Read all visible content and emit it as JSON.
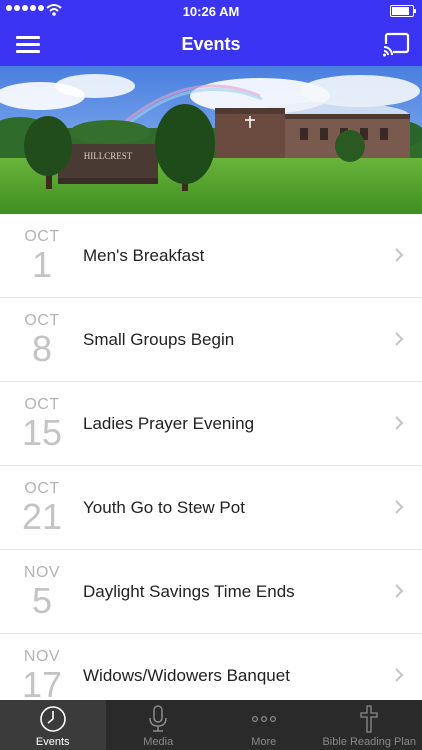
{
  "status_bar": {
    "time": "10:26 AM",
    "battery_level": 0.95
  },
  "nav": {
    "title": "Events"
  },
  "hero": {
    "sign_text": "HILLCREST"
  },
  "events": [
    {
      "month": "OCT",
      "day": "1",
      "name": "Men's Breakfast"
    },
    {
      "month": "OCT",
      "day": "8",
      "name": "Small Groups Begin"
    },
    {
      "month": "OCT",
      "day": "15",
      "name": "Ladies Prayer Evening"
    },
    {
      "month": "OCT",
      "day": "21",
      "name": "Youth Go to Stew Pot"
    },
    {
      "month": "NOV",
      "day": "5",
      "name": "Daylight Savings Time Ends"
    },
    {
      "month": "NOV",
      "day": "17",
      "name": "Widows/Widowers Banquet"
    }
  ],
  "tabs": [
    {
      "label": "Events",
      "icon": "clock-icon"
    },
    {
      "label": "Media",
      "icon": "microphone-icon"
    },
    {
      "label": "More",
      "icon": "ellipsis-icon"
    },
    {
      "label": "Bible Reading Plan",
      "icon": "cross-icon"
    }
  ],
  "colors": {
    "brand": "#3b34f2",
    "tab_bar": "#2a2a2a"
  }
}
